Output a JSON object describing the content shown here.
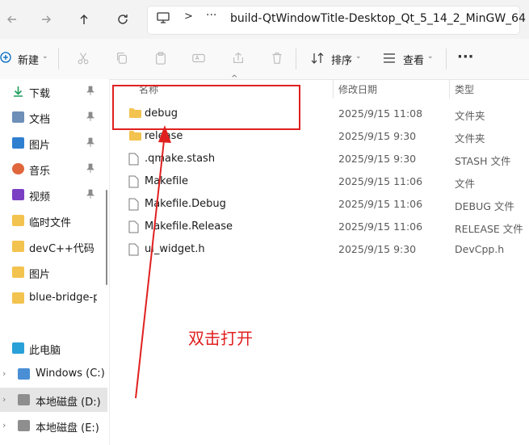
{
  "address": {
    "path": "build-QtWindowTitle-Desktop_Qt_5_14_2_MinGW_64",
    "ellipsis": "···",
    "chevron": ">"
  },
  "toolbar": {
    "new_label": "新建",
    "sort_label": "排序",
    "view_label": "查看",
    "more_label": "···"
  },
  "sidebar": {
    "items": [
      {
        "label": "下载",
        "icon": "download-icon",
        "pinned": true
      },
      {
        "label": "文档",
        "icon": "document-icon",
        "pinned": true
      },
      {
        "label": "图片",
        "icon": "pictures-icon",
        "pinned": true
      },
      {
        "label": "音乐",
        "icon": "music-icon",
        "pinned": true
      },
      {
        "label": "视频",
        "icon": "video-icon",
        "pinned": true
      },
      {
        "label": "临时文件",
        "icon": "folder-icon"
      },
      {
        "label": "devC++代码",
        "icon": "folder-icon"
      },
      {
        "label": "图片",
        "icon": "folder-icon"
      },
      {
        "label": "blue-bridge-pr",
        "icon": "folder-icon"
      }
    ],
    "this_pc": "此电脑",
    "drives": [
      {
        "label": "Windows (C:)"
      },
      {
        "label": "本地磁盘 (D:)"
      },
      {
        "label": "本地磁盘 (E:)"
      }
    ]
  },
  "list": {
    "columns": {
      "name": "名称",
      "date": "修改日期",
      "type": "类型"
    },
    "rows": [
      {
        "name": "debug",
        "date": "2025/9/15 11:08",
        "type": "文件夹",
        "kind": "folder"
      },
      {
        "name": "release",
        "date": "2025/9/15 9:30",
        "type": "文件夹",
        "kind": "folder"
      },
      {
        "name": ".qmake.stash",
        "date": "2025/9/15 9:30",
        "type": "STASH 文件",
        "kind": "file"
      },
      {
        "name": "Makefile",
        "date": "2025/9/15 11:06",
        "type": "文件",
        "kind": "file"
      },
      {
        "name": "Makefile.Debug",
        "date": "2025/9/15 11:06",
        "type": "DEBUG 文件",
        "kind": "file"
      },
      {
        "name": "Makefile.Release",
        "date": "2025/9/15 11:06",
        "type": "RELEASE 文件",
        "kind": "file"
      },
      {
        "name": "ui_widget.h",
        "date": "2025/9/15 9:30",
        "type": "DevCpp.h",
        "kind": "file"
      }
    ]
  },
  "annotation": {
    "text": "双击打开",
    "color": "#e02020"
  },
  "colors": {
    "folder": "#f3c34f",
    "accent": "#0067c0",
    "annotation": "#e02020"
  }
}
